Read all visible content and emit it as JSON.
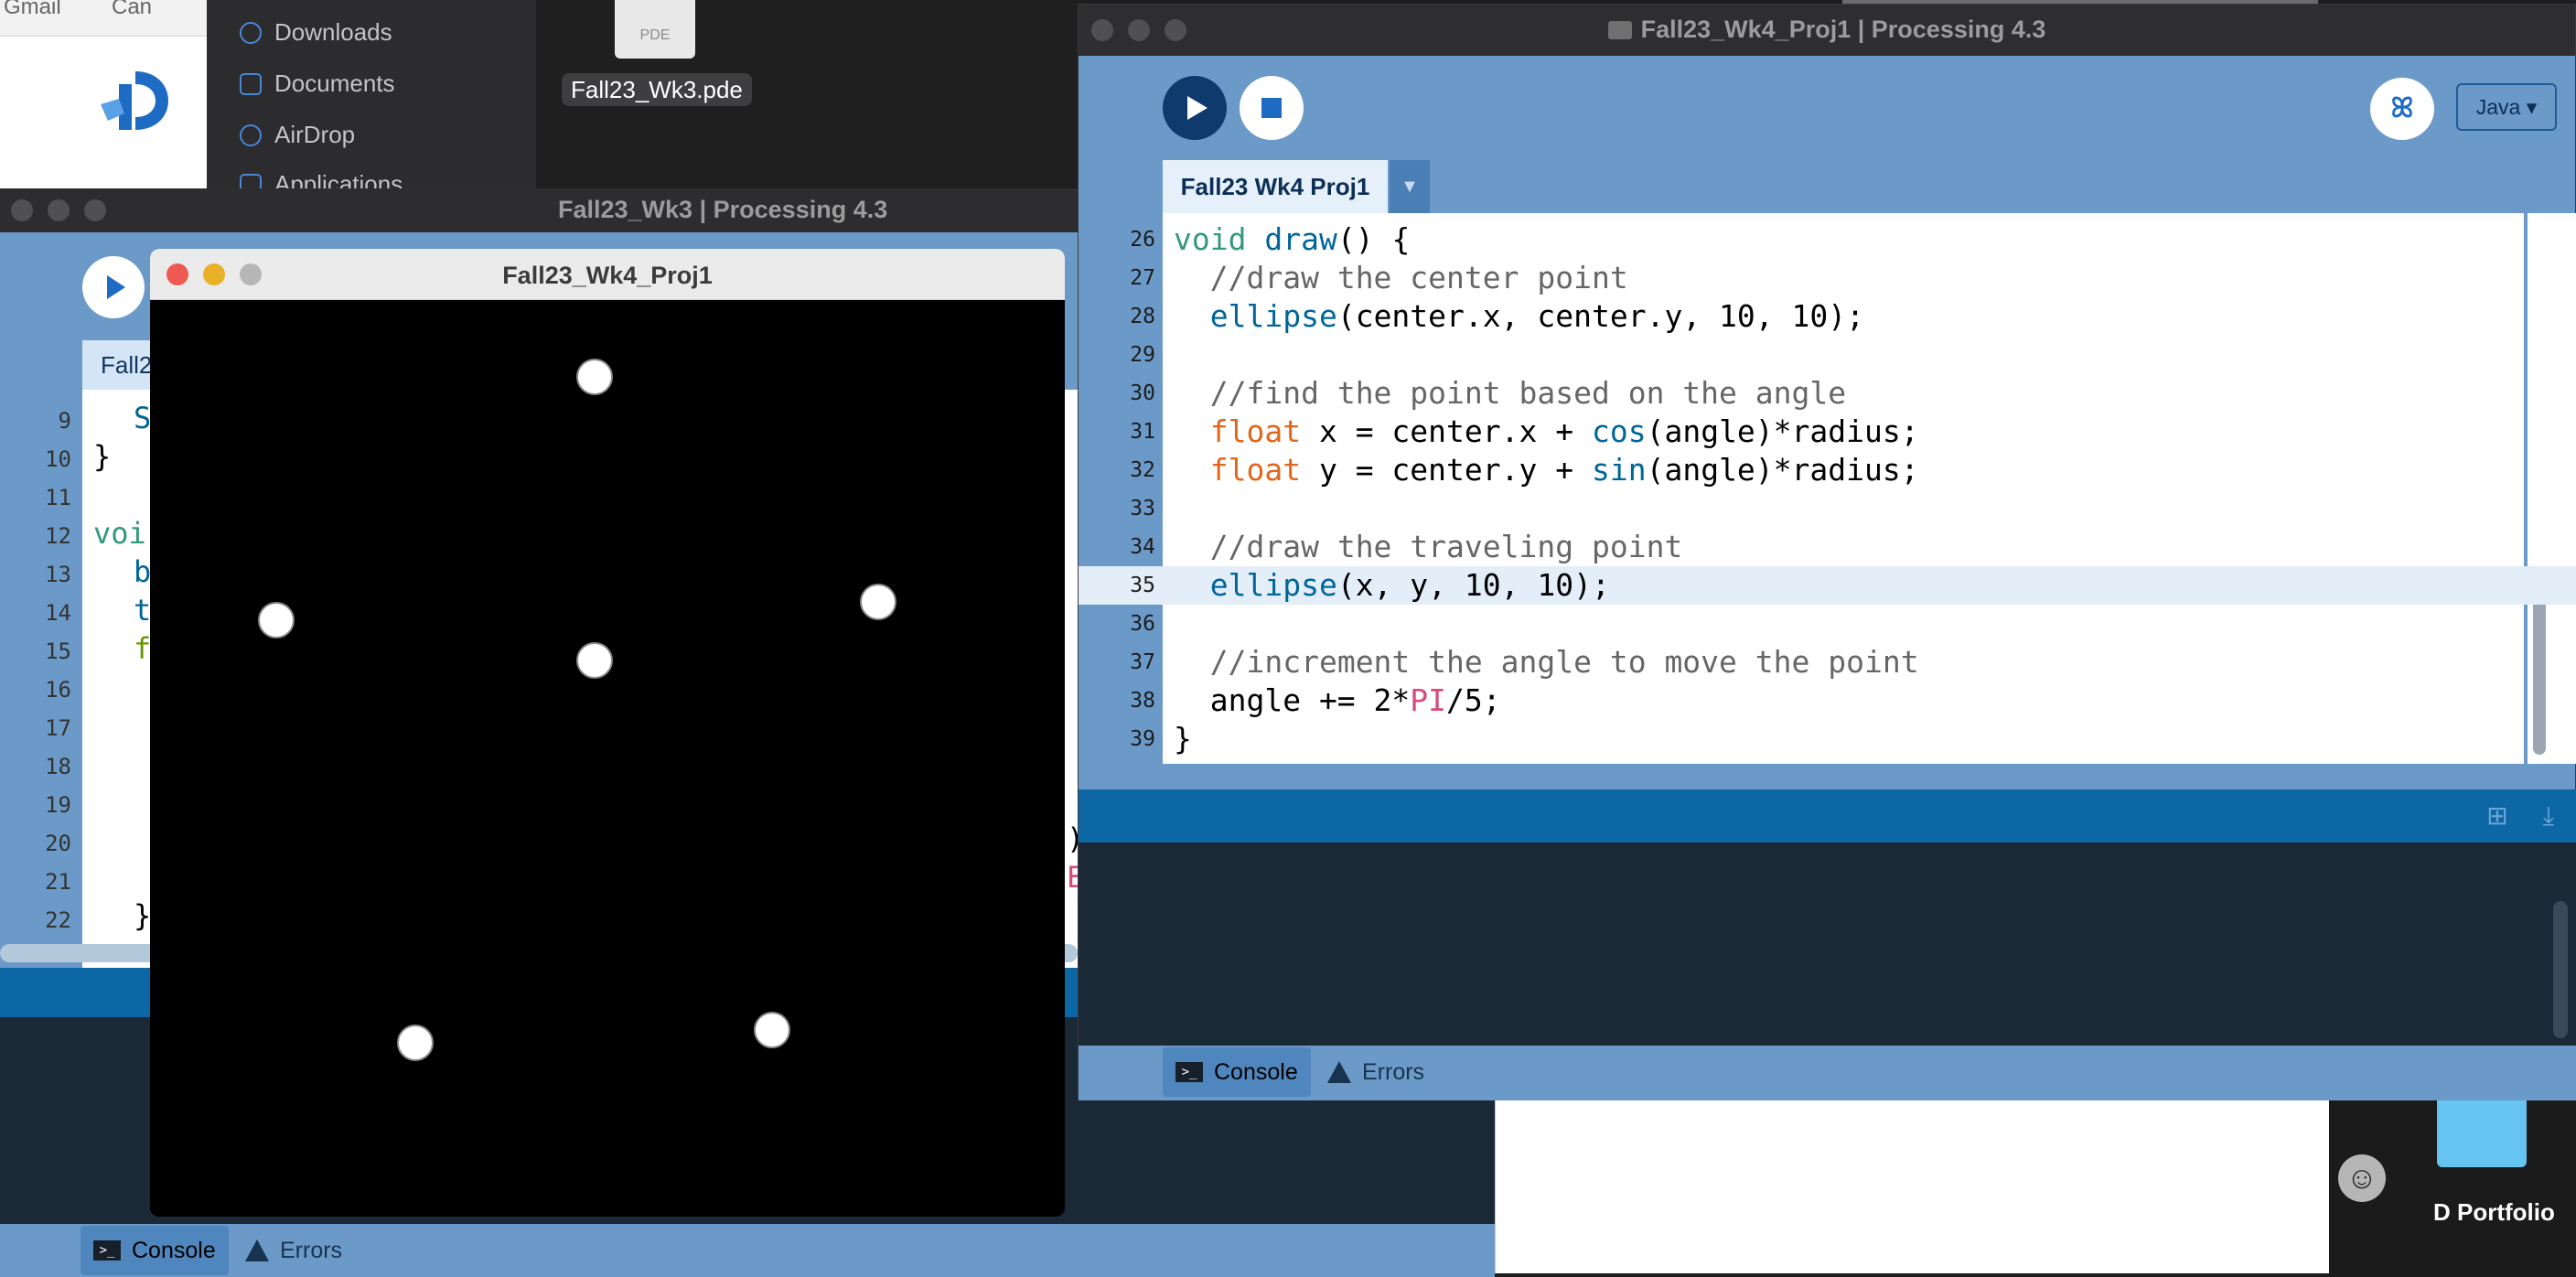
{
  "browser": {
    "tabs": [
      "Gmail",
      "Can"
    ]
  },
  "finder": {
    "sidebar_items": [
      "Downloads",
      "Documents",
      "AirDrop",
      "Applications"
    ],
    "file": {
      "icon_label": "PDE",
      "name": "Fall23_Wk3.pde"
    }
  },
  "background": {
    "portfolio_label": "D Portfolio",
    "smiley_glyph": "☺"
  },
  "wk3_window": {
    "title": "Fall23_Wk3 | Processing 4.3",
    "tab_label": "Fall2",
    "line_numbers": [
      "9",
      "10",
      "11",
      "12",
      "13",
      "14",
      "15",
      "16",
      "17",
      "18",
      "19",
      "20",
      "21",
      "22"
    ],
    "code_fragments": [
      {
        "text": "S",
        "color": "#006699"
      },
      {
        "text": "}",
        "color": "#000000"
      },
      {
        "text": "voi",
        "color": "#33997e"
      },
      {
        "text": "b",
        "color": "#006699"
      },
      {
        "text": "t",
        "color": "#006699"
      },
      {
        "text": "f",
        "color": "#669900"
      },
      {
        "text": ")",
        "color": "#000000"
      },
      {
        "text": "E",
        "color": "#d94a7a"
      },
      {
        "text": "}",
        "color": "#000000"
      }
    ],
    "status": {
      "console_label": "Console",
      "errors_label": "Errors"
    }
  },
  "sketch_window": {
    "title": "Fall23_Wk4_Proj1",
    "background_color": "#000000",
    "point_color": "#ffffff",
    "points_count": 6
  },
  "wk4_window": {
    "title": "Fall23_Wk4_Proj1 | Processing 4.3",
    "mode": "Java ▾",
    "tab_label": "Fall23 Wk4 Proj1",
    "tab_menu_glyph": "▼",
    "debug_glyph": "ꕤ",
    "current_line": "35",
    "code_lines": [
      {
        "num": "26",
        "html": "<span class='kw'>void</span> <span class='fn'>draw</span>() {"
      },
      {
        "num": "27",
        "html": "  <span class='cm'>//draw the center point</span>"
      },
      {
        "num": "28",
        "html": "  <span class='fn'>ellipse</span>(center.x, center.y, 10, 10);"
      },
      {
        "num": "29",
        "html": ""
      },
      {
        "num": "30",
        "html": "  <span class='cm'>//find the point based on the angle</span>"
      },
      {
        "num": "31",
        "html": "  <span class='ty'>float</span> x = center.x + <span class='fn'>cos</span>(angle)*radius;"
      },
      {
        "num": "32",
        "html": "  <span class='ty'>float</span> y = center.y + <span class='fn'>sin</span>(angle)*radius;"
      },
      {
        "num": "33",
        "html": ""
      },
      {
        "num": "34",
        "html": "  <span class='cm'>//draw the traveling point</span>"
      },
      {
        "num": "35",
        "html": "  <span class='fn'>ellipse</span>(x, y, 10, 10);"
      },
      {
        "num": "36",
        "html": ""
      },
      {
        "num": "37",
        "html": "  <span class='cm'>//increment the angle to move the point</span>"
      },
      {
        "num": "38",
        "html": "  angle += 2*<span class='cn'>PI</span>/5;"
      },
      {
        "num": "39",
        "html": "}"
      }
    ],
    "band_icons": {
      "add": "⊞",
      "collapse": "⤓"
    },
    "status": {
      "console_label": "Console",
      "errors_label": "Errors"
    }
  }
}
